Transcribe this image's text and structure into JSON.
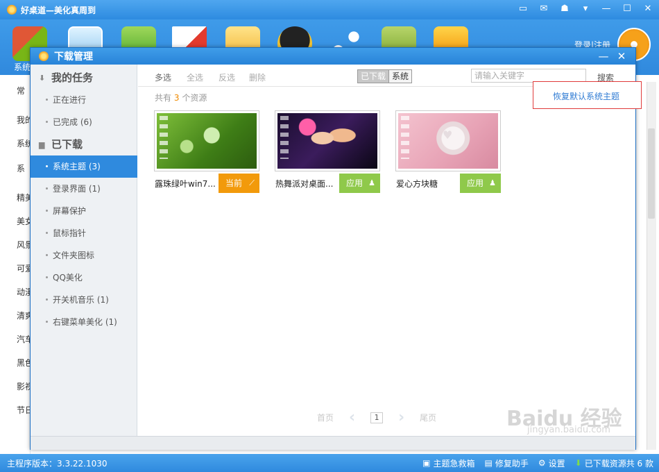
{
  "app": {
    "title": "好桌道—美化真周到",
    "login": "登录|注册",
    "toolbar_first_label": "系统"
  },
  "bg_sidebar": {
    "items": [
      "常",
      "我的",
      "系统",
      "系",
      "精美",
      "美女",
      "风景",
      "可爱",
      "动漫",
      "清爽",
      "汽车",
      "黑色",
      "影视",
      "节日"
    ]
  },
  "dialog": {
    "title": "下载管理",
    "sidebar": {
      "my_tasks": "我的任务",
      "in_progress": "正在进行",
      "completed": "已完成  (6)",
      "downloaded": "已下载",
      "categories": [
        "系统主题  (3)",
        "登录界面  (1)",
        "屏幕保护",
        "鼠标指针",
        "文件夹图标",
        "QQ美化",
        "开关机音乐  (1)",
        "右键菜单美化  (1)"
      ]
    },
    "toolbar": {
      "multi_select": "多选",
      "select_all": "全选",
      "invert": "反选",
      "delete": "删除",
      "seg_downloaded": "已下载",
      "seg_system": "系统",
      "search_placeholder": "请输入关键字",
      "search_button": "搜索"
    },
    "count_prefix": "共有",
    "count_value": "3",
    "count_suffix": "个资源",
    "restore_link": "恢复默认系统主题",
    "cards": [
      {
        "name": "露珠绿叶win7...",
        "button": "当前"
      },
      {
        "name": "热舞派对桌面...",
        "button": "应用"
      },
      {
        "name": "爱心方块糖",
        "button": "应用"
      }
    ],
    "pagination": {
      "first": "首页",
      "current": "1",
      "last": "尾页"
    }
  },
  "statusbar": {
    "version": "主程序版本：3.3.22.1030",
    "rescue": "主题急救箱",
    "repair": "修复助手",
    "settings": "设置",
    "downloaded": "已下载资源共 6 款"
  },
  "watermark": {
    "main": "Baidu 经验",
    "sub": "jingyan.baidu.com"
  },
  "colors": {
    "brand_blue": "#2f8ade",
    "orange": "#f29a0b",
    "green": "#8fc94a",
    "highlight_red": "#e03a3a"
  }
}
